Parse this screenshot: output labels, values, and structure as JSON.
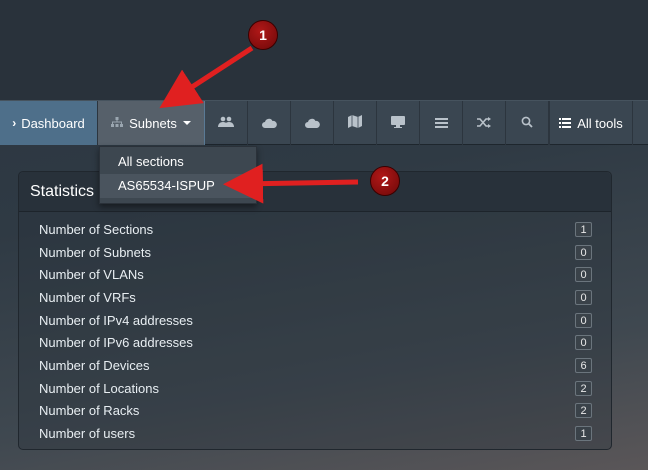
{
  "nav": {
    "dashboard": "Dashboard",
    "subnets": "Subnets",
    "icons": [
      "users-icon",
      "cloud-icon",
      "cloud-icon",
      "map-icon",
      "monitor-icon",
      "list-icon",
      "shuffle-icon",
      "search-icon"
    ],
    "all_tools": "All tools"
  },
  "dropdown": {
    "items": [
      "All sections",
      "AS65534-ISPUP"
    ]
  },
  "panel": {
    "title": "Statistics",
    "rows": [
      {
        "label": "Number of Sections",
        "value": "1"
      },
      {
        "label": "Number of Subnets",
        "value": "0"
      },
      {
        "label": "Number of VLANs",
        "value": "0"
      },
      {
        "label": "Number of VRFs",
        "value": "0"
      },
      {
        "label": "Number of IPv4 addresses",
        "value": "0"
      },
      {
        "label": "Number of IPv6 addresses",
        "value": "0"
      },
      {
        "label": "Number of Devices",
        "value": "6"
      },
      {
        "label": "Number of Locations",
        "value": "2"
      },
      {
        "label": "Number of Racks",
        "value": "2"
      },
      {
        "label": "Number of users",
        "value": "1"
      }
    ]
  },
  "annotations": {
    "marker1": "1",
    "marker2": "2",
    "color": "#e02020"
  }
}
